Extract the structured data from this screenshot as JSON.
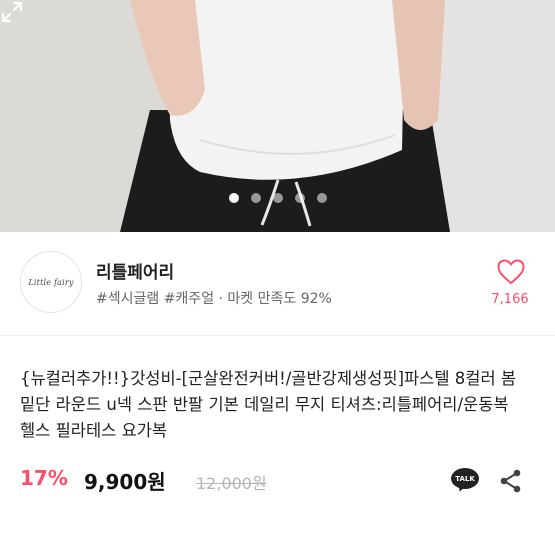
{
  "hero": {
    "image_alt": "",
    "slide_count": 5,
    "active_slide_index": 0,
    "expand_icon": "expand-icon"
  },
  "seller": {
    "logo_text": "Little fairy",
    "name": "리틀페어리",
    "tags": "#섹시글램 #캐주얼 · 마켓 만족도 92%",
    "like_count": "7,166",
    "heart_icon": "heart-icon",
    "accent_color": "#ff4c6a"
  },
  "product": {
    "title": "{뉴컬러추가!!}갓성비-[군살완전커버!/골반강제생성핏]파스텔 8컬러 봄 밑단 라운드 u넥 스판 반팔 기본 데일리 무지 티셔츠:리틀페어리/운동복 헬스 필라테스 요가복",
    "discount": "17%",
    "price": "9,900원",
    "original_price": "12,000원",
    "talk_label": "TALK",
    "share_icon": "share-icon"
  }
}
